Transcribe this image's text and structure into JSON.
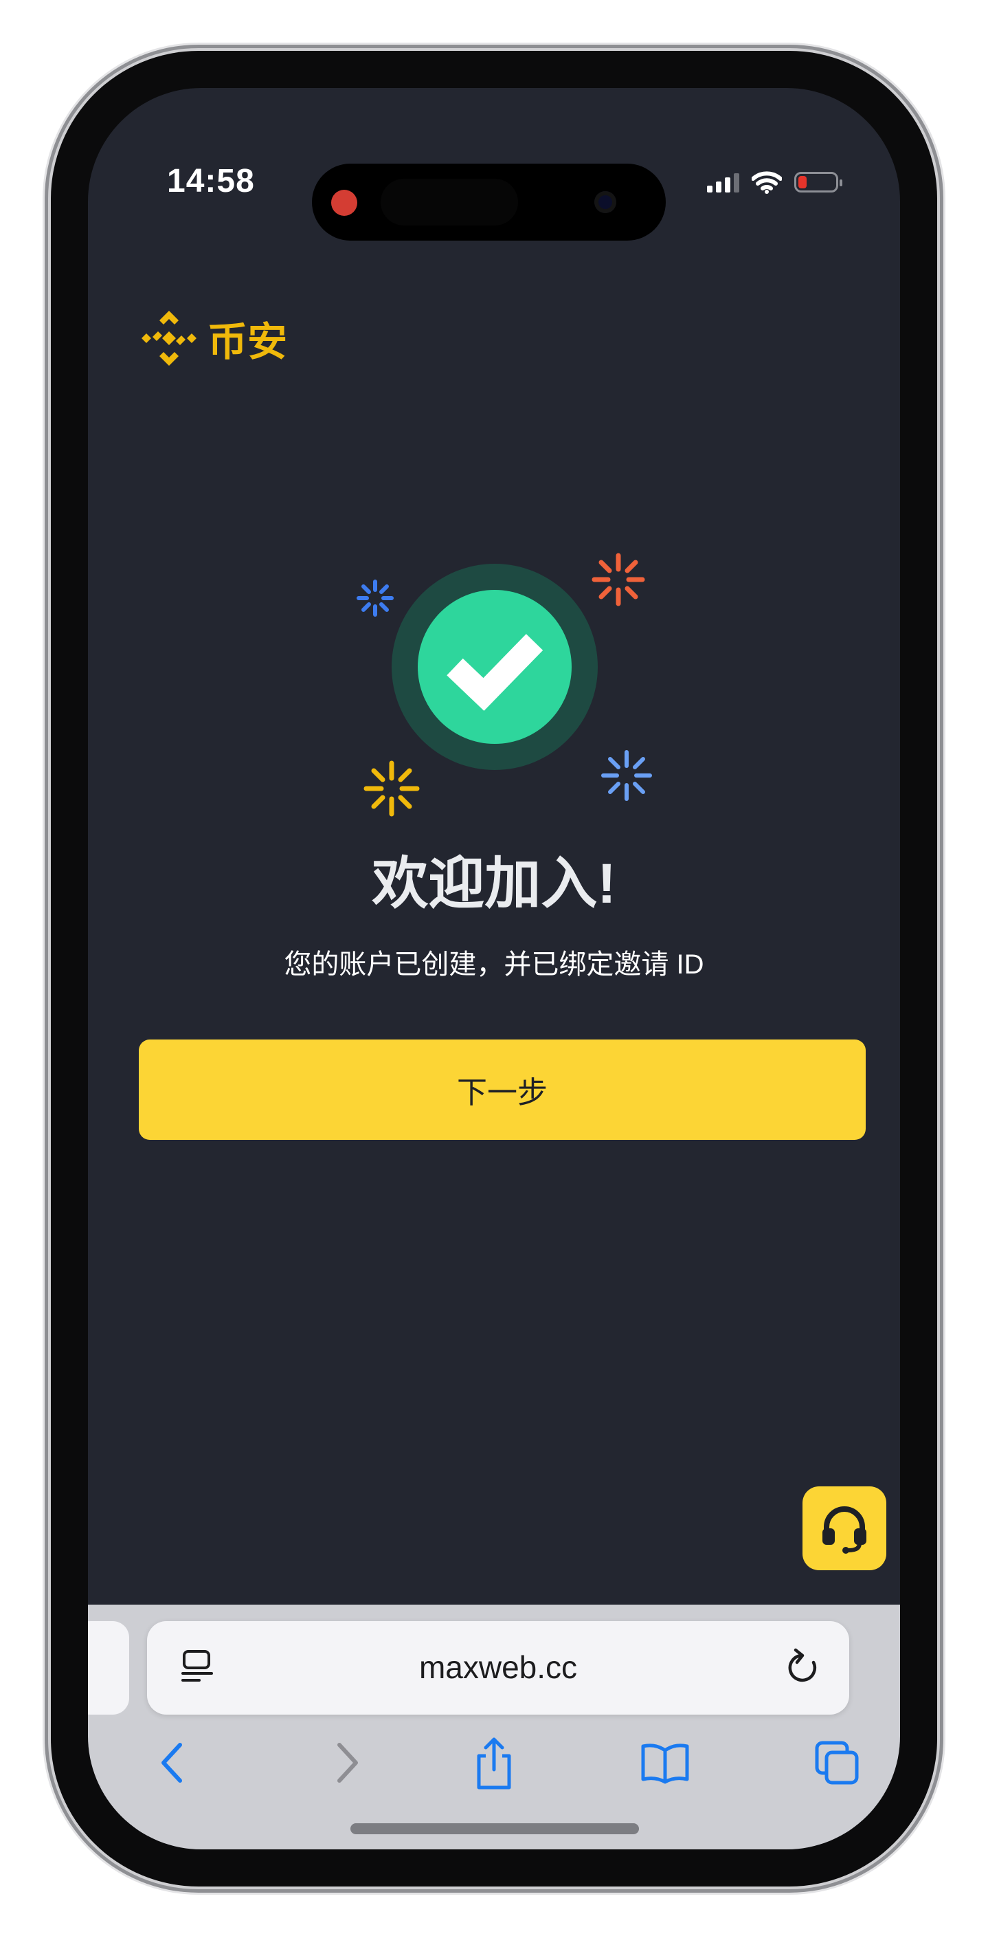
{
  "status_bar": {
    "time": "14:58"
  },
  "brand": {
    "name": "币安",
    "color": "#F0B90B"
  },
  "hero": {
    "icon": "checkmark-success-icon",
    "sparkles": [
      "sparkle-blue-icon",
      "sparkle-orange-icon",
      "sparkle-yellow-icon",
      "sparkle-lightblue-icon"
    ]
  },
  "welcome": {
    "title": "欢迎加入!",
    "subtitle": "您的账户已创建，并已绑定邀请 ID"
  },
  "actions": {
    "next_label": "下一步"
  },
  "support": {
    "icon": "headset-icon"
  },
  "browser": {
    "url": "maxweb.cc",
    "toolbar": [
      "back-icon",
      "forward-icon",
      "share-icon",
      "bookmarks-icon",
      "tabs-icon"
    ]
  },
  "colors": {
    "accent": "#FCD535",
    "background": "#232630",
    "success": "#2ED69C"
  }
}
